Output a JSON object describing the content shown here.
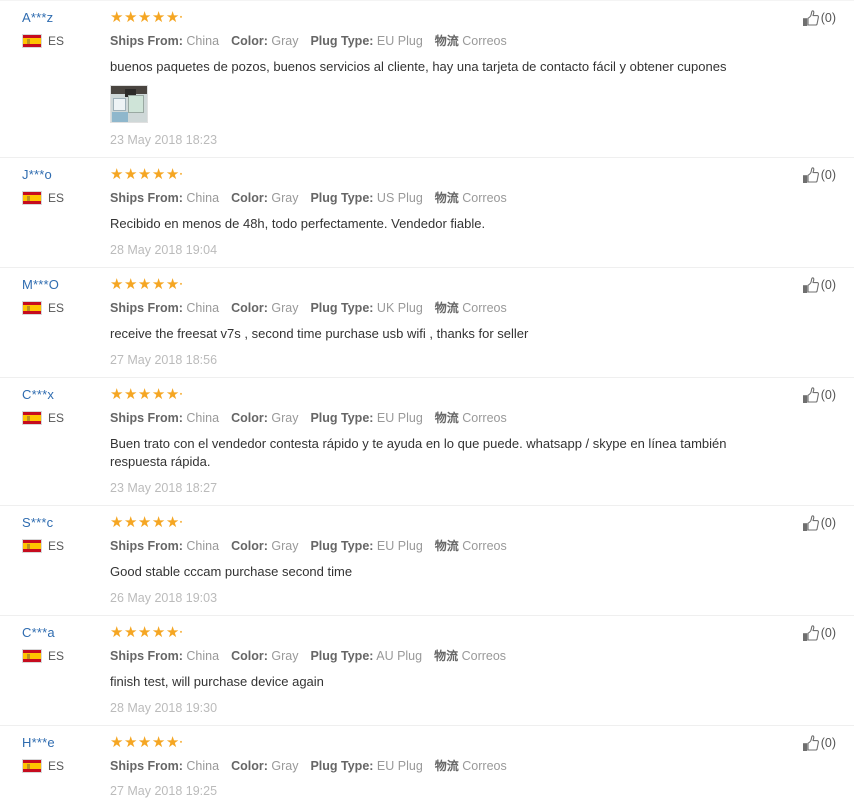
{
  "page": {
    "title": "Product Customer Reviews",
    "accent_blue": "#2f6cb0",
    "star_color": "#f5a623",
    "label_color": "#666666",
    "value_color": "#999999",
    "date_color": "#bbbbbb",
    "separator_color": "#efefef"
  },
  "labels": {
    "ships_from": "Ships From:",
    "color": "Color:",
    "plug_type": "Plug Type:",
    "logistics": "物流",
    "country_code": "ES",
    "flag_icon": "spain-flag-icon",
    "thumb_icon": "thumbs-up-icon"
  },
  "reviews": [
    {
      "user": "A***z",
      "country": "ES",
      "stars": 5,
      "ships_from": "China",
      "color": "Gray",
      "plug_type": "EU Plug",
      "logistics": "Correos",
      "body": "buenos paquetes de pozos, buenos servicios al cliente, hay una tarjeta de contacto fácil y obtener cupones",
      "photos": 1,
      "date": "23 May 2018 18:23",
      "helpful": "(0)"
    },
    {
      "user": "J***o",
      "country": "ES",
      "stars": 5,
      "ships_from": "China",
      "color": "Gray",
      "plug_type": "US Plug",
      "logistics": "Correos",
      "body": "Recibido en menos de 48h, todo perfectamente. Vendedor fiable.",
      "photos": 0,
      "date": "28 May 2018 19:04",
      "helpful": "(0)"
    },
    {
      "user": "M***O",
      "country": "ES",
      "stars": 5,
      "ships_from": "China",
      "color": "Gray",
      "plug_type": "UK Plug",
      "logistics": "Correos",
      "body": "receive the freesat v7s , second time purchase usb wifi , thanks for seller",
      "photos": 0,
      "date": "27 May 2018 18:56",
      "helpful": "(0)"
    },
    {
      "user": "C***x",
      "country": "ES",
      "stars": 5,
      "ships_from": "China",
      "color": "Gray",
      "plug_type": "EU Plug",
      "logistics": "Correos",
      "body": "Buen trato con el vendedor contesta rápido y te ayuda en lo que puede. whatsapp / skype en línea también respuesta rápida.",
      "photos": 0,
      "date": "23 May 2018 18:27",
      "helpful": "(0)"
    },
    {
      "user": "S***c",
      "country": "ES",
      "stars": 5,
      "ships_from": "China",
      "color": "Gray",
      "plug_type": "EU Plug",
      "logistics": "Correos",
      "body": "Good stable cccam purchase second time",
      "photos": 0,
      "date": "26 May 2018 19:03",
      "helpful": "(0)"
    },
    {
      "user": "C***a",
      "country": "ES",
      "stars": 5,
      "ships_from": "China",
      "color": "Gray",
      "plug_type": "AU Plug",
      "logistics": "Correos",
      "body": "finish test, will purchase device again",
      "photos": 0,
      "date": "28 May 2018 19:30",
      "helpful": "(0)"
    },
    {
      "user": "H***e",
      "country": "ES",
      "stars": 5,
      "ships_from": "China",
      "color": "Gray",
      "plug_type": "EU Plug",
      "logistics": "Correos",
      "body": "",
      "photos": 0,
      "date": "27 May 2018 19:25",
      "helpful": "(0)"
    }
  ]
}
